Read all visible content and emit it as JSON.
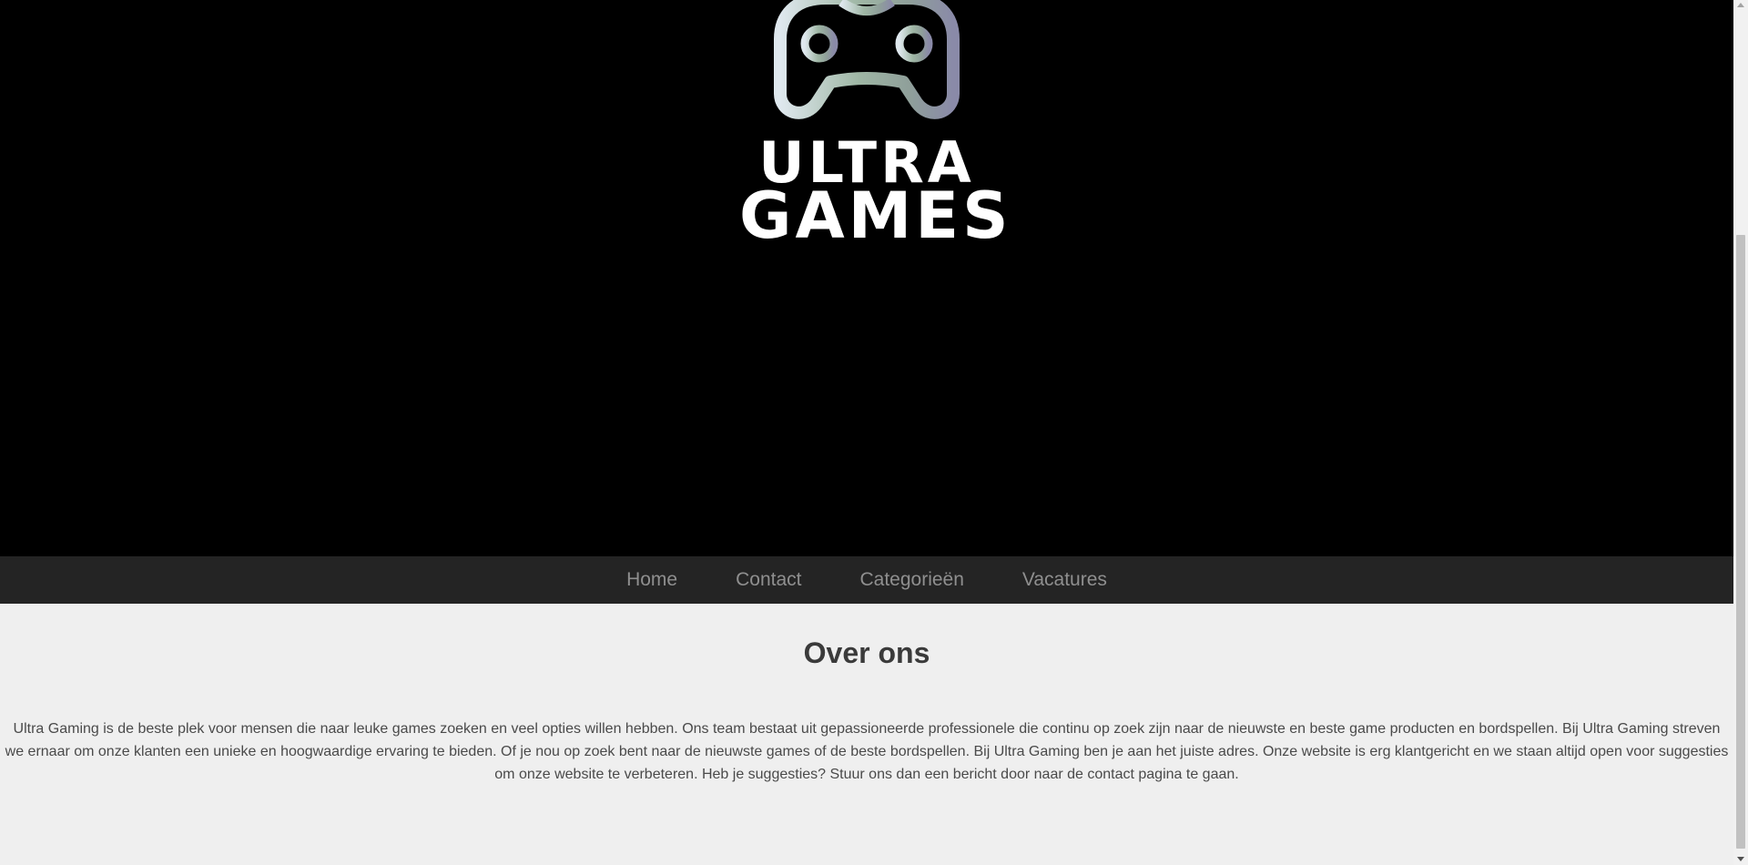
{
  "logo": {
    "icon": "gamepad-icon",
    "line1": "ULTRA",
    "line2": "GAMES",
    "colors": {
      "background": "#000000",
      "text": "#ffffff"
    }
  },
  "nav": {
    "items": [
      {
        "label": "Home"
      },
      {
        "label": "Contact"
      },
      {
        "label": "Categorieën"
      },
      {
        "label": "Vacatures"
      }
    ],
    "background": "#242424",
    "link_color": "#8f8f8f"
  },
  "about": {
    "title": "Over ons",
    "body": "Ultra Gaming is de beste plek voor mensen die naar leuke games zoeken en veel opties willen hebben. Ons team bestaat uit gepassioneerde professionele die continu op zoek zijn naar de nieuwste en beste game producten en bordspellen. Bij Ultra Gaming streven we ernaar om onze klanten een unieke en hoogwaardige ervaring te bieden. Of je nou op zoek bent naar de nieuwste games of de beste bordspellen. Bij Ultra Gaming ben je aan het juiste adres. Onze website is erg klantgericht en we staan altijd open voor suggesties om onze website te verbeteren. Heb je suggesties? Stuur ons dan een bericht door naar de contact pagina te gaan."
  }
}
